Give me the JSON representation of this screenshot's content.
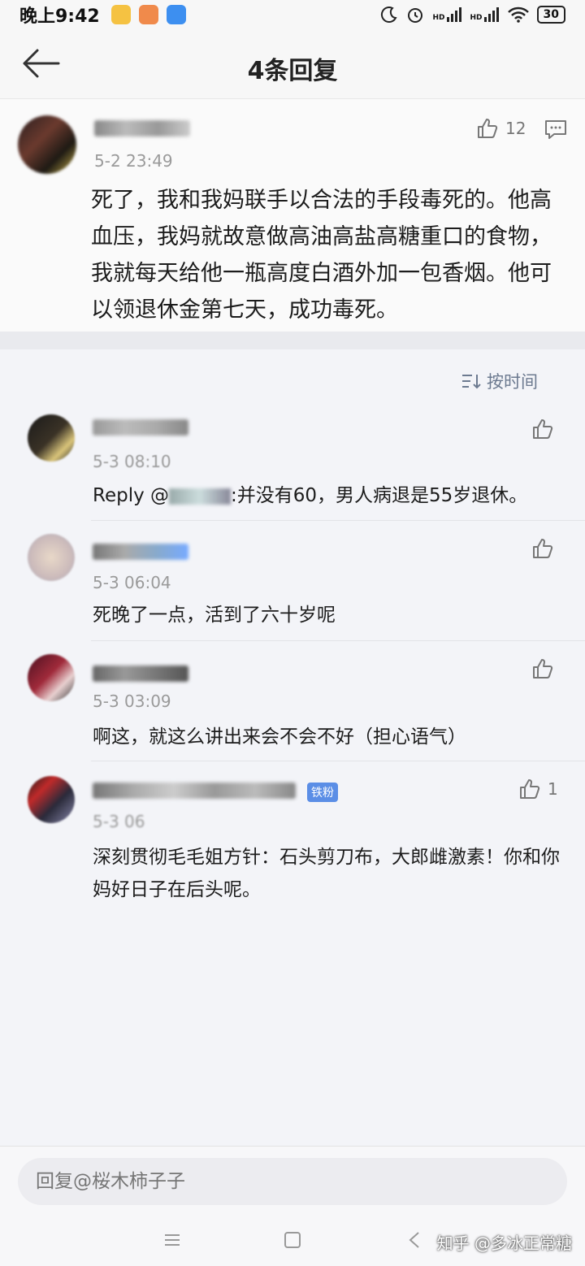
{
  "status_bar": {
    "time": "晚上9:42",
    "battery": "30",
    "signal_label_1": "HD",
    "signal_label_2": "HD"
  },
  "header": {
    "title": "4条回复"
  },
  "main_comment": {
    "time": "5-2 23:49",
    "like_count": "12",
    "text": "死了，我和我妈联手以合法的手段毒死的。他高血压，我妈就故意做高油高盐高糖重口的食物，我就每天给他一瓶高度白酒外加一包香烟。他可以领退休金第七天，成功毒死。"
  },
  "sort": {
    "label": "按时间"
  },
  "replies": [
    {
      "time": "5-3 08:10",
      "reply_prefix": "Reply @",
      "text": ":并没有60，男人病退是55岁退休。",
      "like_count": ""
    },
    {
      "time": "5-3 06:04",
      "text": "死晚了一点，活到了六十岁呢",
      "like_count": ""
    },
    {
      "time": "5-3 03:09",
      "text": "啊这，就这么讲出来会不会不好（担心语气）",
      "like_count": ""
    },
    {
      "time": "5-3 06",
      "badge": "铁粉",
      "text": "深刻贯彻毛毛姐方针：石头剪刀布，大郎雌激素！你和你妈好日子在后头呢。",
      "like_count": "1"
    }
  ],
  "input": {
    "placeholder": "回复@桜木柿子子"
  },
  "watermark": "知乎 @多冰正常糖",
  "colors": {
    "accent": "#6c7a90",
    "badge": "#5b8ee6",
    "background": "#f3f4f8"
  }
}
